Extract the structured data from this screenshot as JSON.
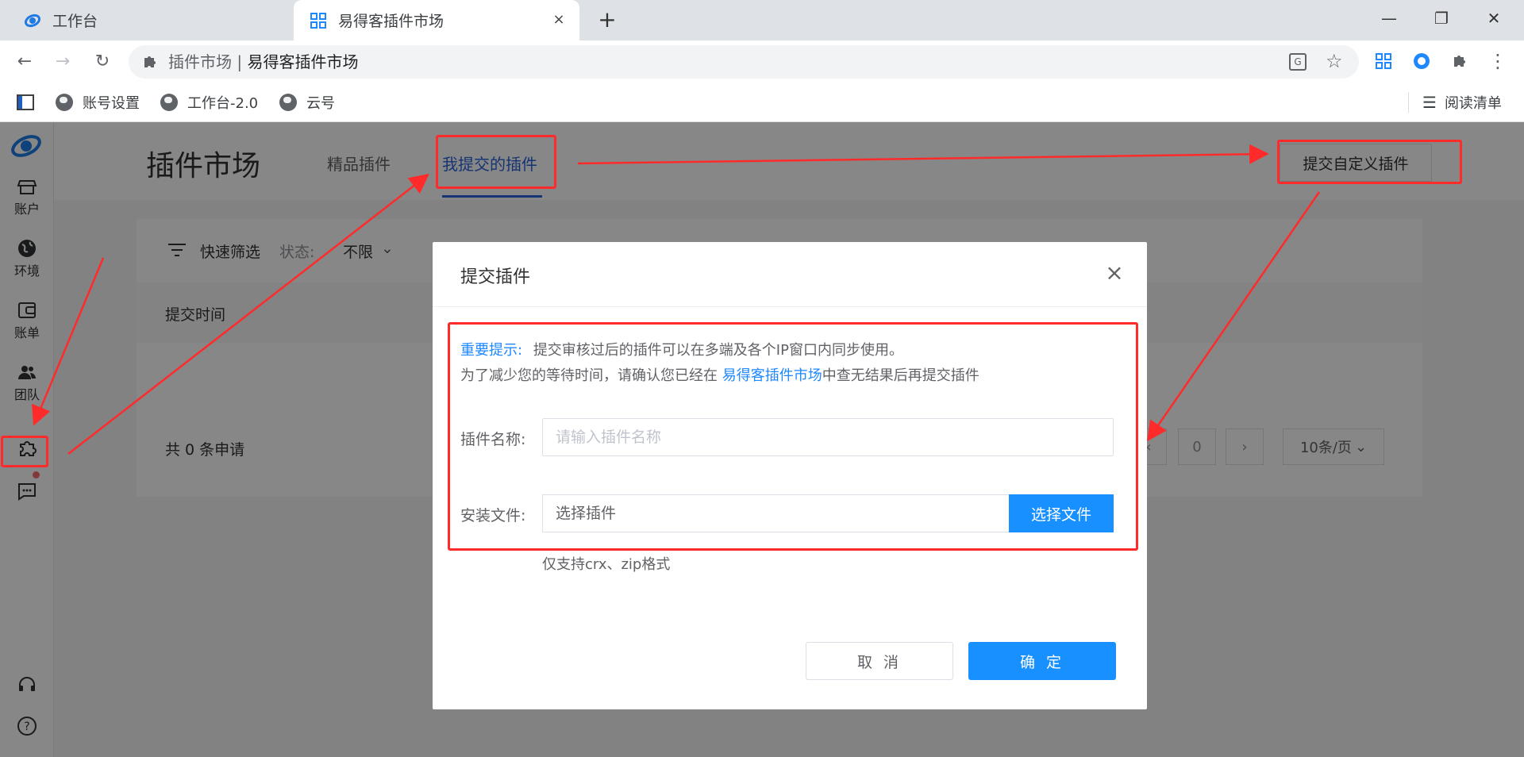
{
  "browser": {
    "tabs": [
      {
        "title": "工作台",
        "icon": "app-logo-icon"
      },
      {
        "title": "易得客插件市场",
        "icon": "grid-icon",
        "close": "×"
      }
    ],
    "new_tab": "+",
    "window": {
      "minimize": "—",
      "restore": "❐",
      "close": "✕"
    },
    "address": {
      "prefix": "插件市场",
      "separator": "|",
      "url": "易得客插件市场"
    },
    "bookmarks": [
      {
        "label": "账号设置"
      },
      {
        "label": "工作台-2.0"
      },
      {
        "label": "云号"
      }
    ],
    "reading_list": "阅读清单"
  },
  "sidebar": {
    "items": [
      {
        "label": "账户",
        "icon": "store-icon"
      },
      {
        "label": "环境",
        "icon": "globe-icon"
      },
      {
        "label": "账单",
        "icon": "wallet-icon"
      },
      {
        "label": "团队",
        "icon": "team-icon"
      },
      {
        "label": "",
        "icon": "puzzle-icon"
      },
      {
        "label": "",
        "icon": "chat-icon"
      }
    ]
  },
  "header": {
    "title": "插件市场",
    "tabs": [
      {
        "label": "精品插件"
      },
      {
        "label": "我提交的插件",
        "active": true
      }
    ],
    "submit_custom": "提交自定义插件"
  },
  "filter": {
    "label": "快速筛选",
    "status_label": "状态:",
    "status_value": "不限"
  },
  "table": {
    "columns": [
      "提交时间"
    ]
  },
  "pager": {
    "total": "共 0 条申请",
    "page": "0",
    "page_size": "10条/页"
  },
  "modal": {
    "title": "提交插件",
    "notice_important": "重要提示:",
    "notice_line1": "提交审核过后的插件可以在多端及各个IP窗口内同步使用。",
    "notice_line2_prefix": "为了减少您的等待时间，请确认您已经在",
    "notice_link": "易得客插件市场",
    "notice_line2_suffix": "中查无结果后再提交插件",
    "name_label": "插件名称:",
    "name_placeholder": "请输入插件名称",
    "file_label": "安装文件:",
    "file_value": "选择插件",
    "file_button": "选择文件",
    "hint": "仅支持crx、zip格式",
    "cancel": "取 消",
    "confirm": "确 定"
  },
  "colors": {
    "primary": "#1890ff",
    "annotation": "#ff2a2a",
    "active_tab": "#2b63d9"
  }
}
